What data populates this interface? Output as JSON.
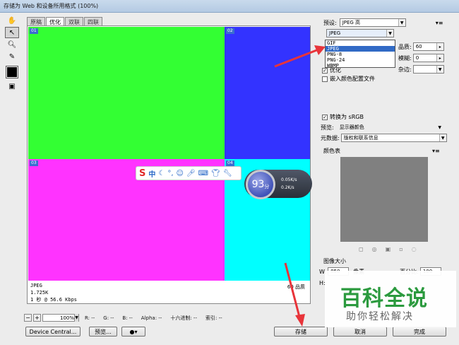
{
  "window": {
    "title": "存储为 Web 和设备所用格式 (100%)"
  },
  "tabs": [
    "原稿",
    "优化",
    "双联",
    "四联"
  ],
  "active_tab": 1,
  "slices": [
    {
      "tag": "01",
      "color": "#33ff33"
    },
    {
      "tag": "02",
      "color": "#3333ff"
    },
    {
      "tag": "03",
      "color": "#ff33ff"
    },
    {
      "tag": "04",
      "color": "#00ffff"
    }
  ],
  "preview_info": {
    "format": "JPEG",
    "size": "1.725K",
    "time": "1 秒 @ 56.6 Kbps",
    "quality_label": "60 品质"
  },
  "ime": {
    "logo": "S",
    "lang": "中"
  },
  "speed_widget": {
    "value": "93",
    "unit": "分",
    "up": "0.05K/s",
    "down": "0.2K/s"
  },
  "status": {
    "zoom": "100%",
    "r": "R: --",
    "g": "G: --",
    "b": "B: --",
    "alpha": "Alpha: --",
    "hex": "十六进制: --",
    "index": "索引: --"
  },
  "buttons": {
    "device_central": "Device Central...",
    "preview": "预览...",
    "save": "存储",
    "cancel": "取消",
    "done": "完成"
  },
  "panel": {
    "preset_label": "预设:",
    "preset_value": "JPEG 高",
    "format_value": "JPEG",
    "format_options": [
      "GIF",
      "JPEG",
      "PNG-8",
      "PNG-24",
      "WBMP"
    ],
    "format_selected_index": 1,
    "quality_label": "品质:",
    "quality_value": "60",
    "blur_label": "模糊:",
    "blur_value": "0",
    "matte_label": "杂边:",
    "optimized_label": "优化",
    "embed_profile_label": "嵌入颜色配置文件",
    "convert_srgb_label": "转换为 sRGB",
    "preview_label": "预览:",
    "preview_value": "显示器颜色",
    "metadata_label": "元数据:",
    "metadata_value": "版权和联系信息",
    "color_table_label": "颜色表",
    "image_size_label": "图像大小",
    "width_label": "W:",
    "width_value": "850",
    "px_label": "像素",
    "percent_label": "百分比:",
    "percent_value": "100",
    "height_label": "H:"
  },
  "watermark": {
    "title": "百科全说",
    "subtitle": "助你轻松解决"
  },
  "colors": {
    "accent": "#316ac5",
    "arrow": "#e8343a",
    "watermark_green": "#2b9a3e"
  }
}
